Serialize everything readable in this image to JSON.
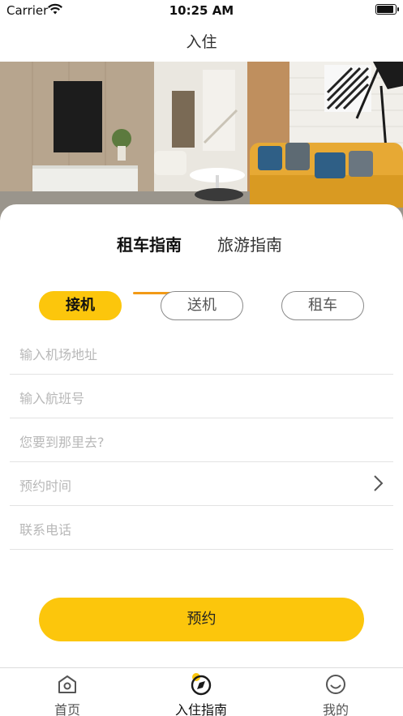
{
  "status_bar": {
    "carrier": "Carrier",
    "time": "10:25 AM",
    "battery_level": 0.95
  },
  "nav": {
    "title": "入住"
  },
  "hero": {
    "image": "living-room-interior-photo"
  },
  "tabs": [
    {
      "label": "租车指南",
      "active": true
    },
    {
      "label": "旅游指南",
      "active": false
    }
  ],
  "segments": [
    {
      "label": "接机",
      "active": true
    },
    {
      "label": "送机",
      "active": false
    },
    {
      "label": "租车",
      "active": false
    }
  ],
  "fields": {
    "airport_address": {
      "placeholder": "输入机场地址"
    },
    "flight_number": {
      "placeholder": "输入航班号"
    },
    "destination": {
      "placeholder": "您要到那里去?"
    },
    "booking_time": {
      "label": "预约时间"
    },
    "phone": {
      "placeholder": "联系电话"
    }
  },
  "book_button": {
    "label": "预约"
  },
  "tab_bar": [
    {
      "label": "首页",
      "icon": "home-icon",
      "active": false
    },
    {
      "label": "入住指南",
      "icon": "compass-icon",
      "active": true
    },
    {
      "label": "我的",
      "icon": "smiley-icon",
      "active": false
    }
  ],
  "colors": {
    "accent": "#fcc60c",
    "tab_indicator": "#f29a16",
    "placeholder": "#b8b8b8"
  }
}
